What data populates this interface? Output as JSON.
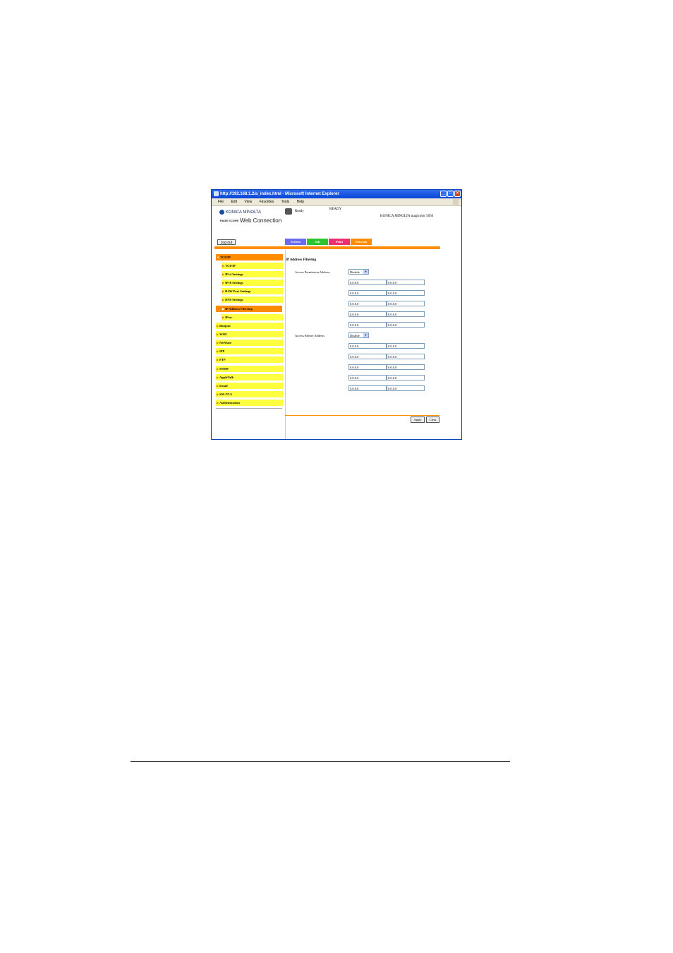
{
  "window": {
    "title": "http://192.168.1.2/a_index.html - Microsoft Internet Explorer",
    "menu": [
      "File",
      "Edit",
      "View",
      "Favorites",
      "Tools",
      "Help"
    ]
  },
  "header": {
    "brand": "KONICA MINOLTA",
    "pagescope": "PAGE SCOPE",
    "web_connection": "Web Connection",
    "status_icon_label": "Ready",
    "status_text": "READY",
    "model": "KONICA MINOLTA magicolor 5650",
    "logout_label": "Log out"
  },
  "tabs": [
    {
      "label": "System",
      "color": "#6b6bf0"
    },
    {
      "label": "Job",
      "color": "#2ec42e"
    },
    {
      "label": "Print",
      "color": "#ee2e6e"
    },
    {
      "label": "Network",
      "color": "#ff8c00"
    }
  ],
  "sidebar": {
    "items": [
      {
        "label": "TCP/IP"
      },
      {
        "label": "TCP/IP"
      },
      {
        "label": "IPv4 Settings"
      },
      {
        "label": "IPv6 Settings"
      },
      {
        "label": "RAW Port Settings"
      },
      {
        "label": "DNS Settings"
      },
      {
        "label": "IP Address Filtering"
      },
      {
        "label": "IPsec"
      },
      {
        "label": "Bonjour"
      },
      {
        "label": "WSD"
      },
      {
        "label": "NetWare"
      },
      {
        "label": "IPP"
      },
      {
        "label": "FTP"
      },
      {
        "label": "SNMP"
      },
      {
        "label": "AppleTalk"
      },
      {
        "label": "Email"
      },
      {
        "label": "SSL/TLS"
      },
      {
        "label": "Authentication"
      }
    ]
  },
  "main": {
    "title": "IP Address Filtering",
    "permission": {
      "label": "Access Permission Address",
      "select": "Disable",
      "rows": [
        [
          "0.0.0.0",
          "0.0.0.0"
        ],
        [
          "0.0.0.0",
          "0.0.0.0"
        ],
        [
          "0.0.0.0",
          "0.0.0.0"
        ],
        [
          "0.0.0.0",
          "0.0.0.0"
        ],
        [
          "0.0.0.0",
          "0.0.0.0"
        ]
      ]
    },
    "refuse": {
      "label": "Access Refuse Address",
      "select": "Disable",
      "rows": [
        [
          "0.0.0.0",
          "0.0.0.0"
        ],
        [
          "0.0.0.0",
          "0.0.0.0"
        ],
        [
          "0.0.0.0",
          "0.0.0.0"
        ],
        [
          "0.0.0.0",
          "0.0.0.0"
        ],
        [
          "0.0.0.0",
          "0.0.0.0"
        ]
      ]
    },
    "separator": "-",
    "apply_label": "Apply",
    "clear_label": "Clear"
  }
}
